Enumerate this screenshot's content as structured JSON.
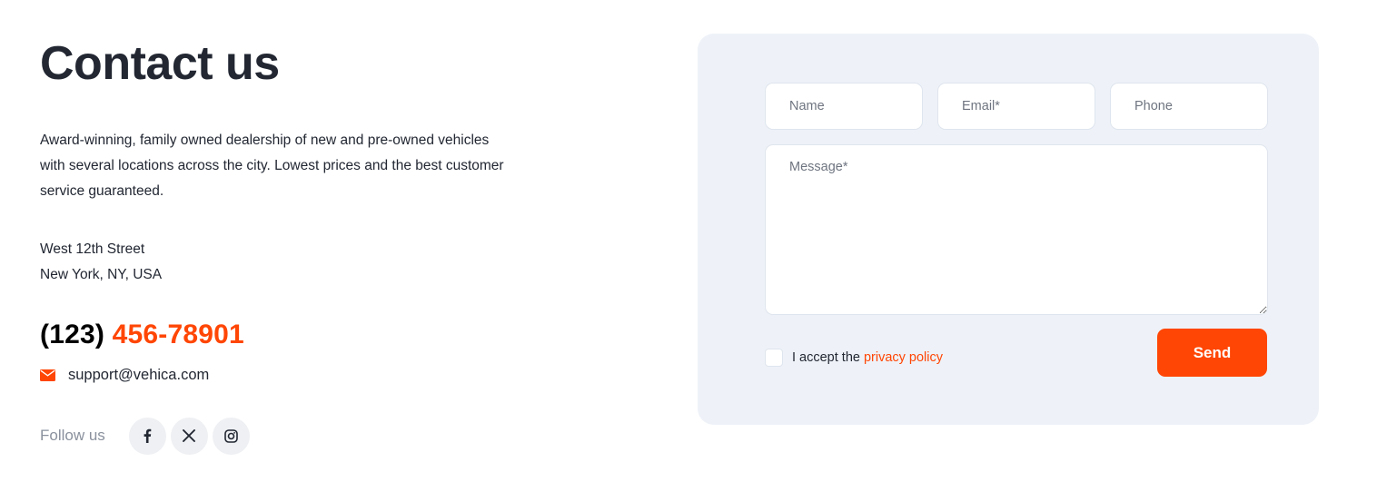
{
  "contact": {
    "title": "Contact us",
    "description": "Award-winning, family owned dealership of new and pre-owned vehicles with several locations across the city. Lowest prices and the best customer service guaranteed.",
    "address_line1": "West 12th Street",
    "address_line2": "New York, NY, USA",
    "phone_area": "(123)",
    "phone_number": "456-78901",
    "email": "support@vehica.com",
    "follow_label": "Follow us",
    "socials": [
      {
        "name": "facebook-icon"
      },
      {
        "name": "x-icon"
      },
      {
        "name": "instagram-icon"
      }
    ]
  },
  "form": {
    "name_placeholder": "Name",
    "email_placeholder": "Email*",
    "phone_placeholder": "Phone",
    "message_placeholder": "Message*",
    "accept_text": "I accept the",
    "privacy_link": "privacy policy",
    "send_label": "Send"
  },
  "colors": {
    "accent": "#ff4605",
    "text": "#222732",
    "muted": "#8a919d",
    "card_bg": "#eef2f8"
  }
}
